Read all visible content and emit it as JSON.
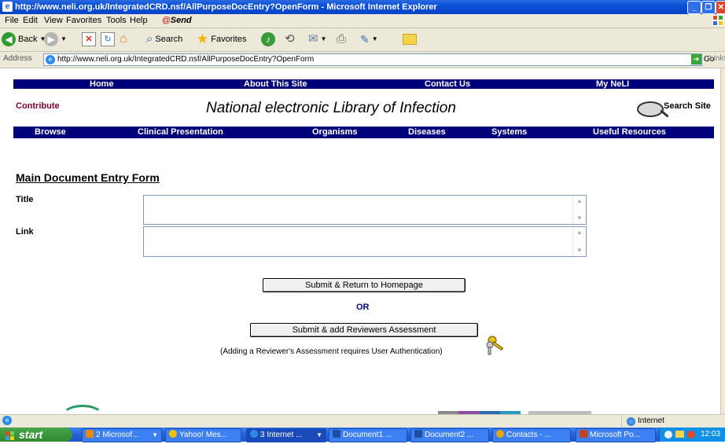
{
  "window": {
    "title": "http://www.neli.org.uk/IntegratedCRD.nsf/AllPurposeDocEntry?OpenForm - Microsoft Internet Explorer",
    "controls": [
      "_",
      "❐",
      "✕"
    ]
  },
  "menubar": {
    "items": [
      "File",
      "Edit",
      "View",
      "Favorites",
      "Tools",
      "Help"
    ],
    "send_label": "Send"
  },
  "toolbar": {
    "back_label": "Back",
    "search_label": "Search",
    "favorites_label": "Favorites"
  },
  "address_bar": {
    "label": "Address",
    "url": "http://www.neli.org.uk/IntegratedCRD.nsf/AllPurposeDocEntry?OpenForm",
    "go_label": "Go",
    "links_label": "Links"
  },
  "page": {
    "top_nav": [
      "Home",
      "About This Site",
      "Contact Us",
      "My NeLI"
    ],
    "contribute_label": "Contribute",
    "site_title": "National electronic Library of Infection",
    "search_site_label": "Search Site",
    "sub_nav": [
      "Browse",
      "Clinical Presentation",
      "Organisms",
      "Diseases",
      "Systems",
      "Useful Resources"
    ],
    "form_heading": "Main Document Entry Form",
    "title_label": "Title",
    "title_value": "",
    "link_label": "Link",
    "link_value": "",
    "submit_home_label": "Submit & Return to Homepage",
    "or_label": "OR",
    "submit_reviewers_label": "Submit & add Reviewers Assessment",
    "auth_note": "(Adding a Reviewer's Assessment requires User Authentication)"
  },
  "statusbar": {
    "zone_label": "Internet"
  },
  "taskbar": {
    "start_label": "start",
    "tasks": [
      {
        "label": "2 Microsof...",
        "icon_color": "#e68a00"
      },
      {
        "label": "Yahoo! Mes...",
        "icon_color": "#f2c200"
      },
      {
        "label": "3 Internet ...",
        "icon_color": "#2d8ae6"
      },
      {
        "label": "Document1 ...",
        "icon_color": "#1d4fa0"
      },
      {
        "label": "Document2 ...",
        "icon_color": "#1d4fa0"
      },
      {
        "label": "Contacts - ...",
        "icon_color": "#e6a800"
      },
      {
        "label": "Microsoft Po...",
        "icon_color": "#c8411c"
      }
    ],
    "clock": "12:03"
  },
  "colors": {
    "nav_bg": "#00007a",
    "contribute": "#7a0030",
    "or_text": "#00007a"
  }
}
